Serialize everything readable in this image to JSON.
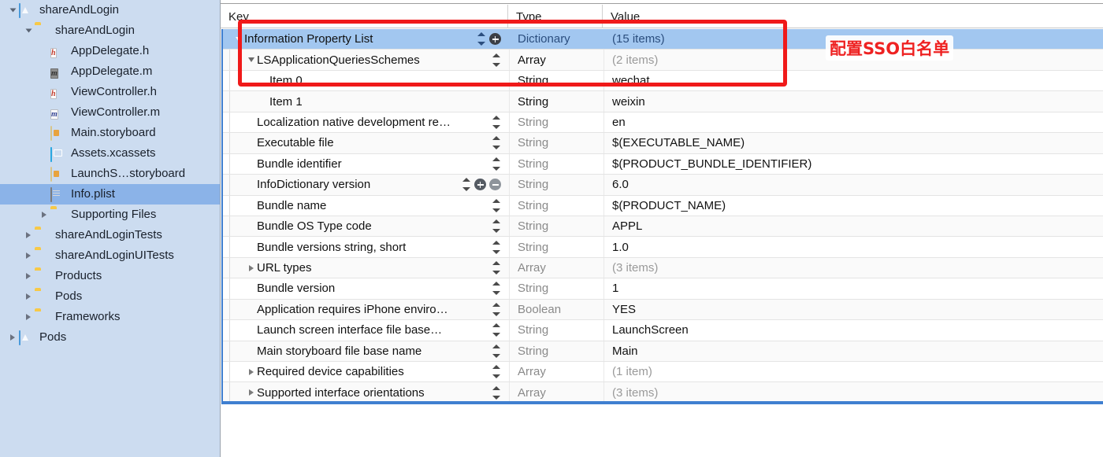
{
  "navigator": {
    "items": [
      {
        "label": "shareAndLogin",
        "icon": "project-icon",
        "indent": 0,
        "disclosure": "open",
        "selected": false
      },
      {
        "label": "shareAndLogin",
        "icon": "folder-icon",
        "indent": 1,
        "disclosure": "open",
        "selected": false
      },
      {
        "label": "AppDelegate.h",
        "icon": "header-file-icon",
        "glyph": "h",
        "indent": 2,
        "disclosure": "none",
        "selected": false
      },
      {
        "label": "AppDelegate.m",
        "icon": "implementation-file-icon",
        "glyph": "m",
        "indent": 2,
        "disclosure": "none",
        "selected": false
      },
      {
        "label": "ViewController.h",
        "icon": "header-file-icon",
        "glyph": "h",
        "indent": 2,
        "disclosure": "none",
        "selected": false
      },
      {
        "label": "ViewController.m",
        "icon": "implementation-file-icon",
        "glyph": "m",
        "indent": 2,
        "disclosure": "none",
        "selected": false
      },
      {
        "label": "Main.storyboard",
        "icon": "storyboard-icon",
        "indent": 2,
        "disclosure": "none",
        "selected": false
      },
      {
        "label": "Assets.xcassets",
        "icon": "assets-catalog-icon",
        "indent": 2,
        "disclosure": "none",
        "selected": false
      },
      {
        "label": "LaunchS…storyboard",
        "icon": "storyboard-icon",
        "indent": 2,
        "disclosure": "none",
        "selected": false
      },
      {
        "label": "Info.plist",
        "icon": "plist-icon",
        "indent": 2,
        "disclosure": "none",
        "selected": true
      },
      {
        "label": "Supporting Files",
        "icon": "folder-icon",
        "indent": 2,
        "disclosure": "closed",
        "selected": false
      },
      {
        "label": "shareAndLoginTests",
        "icon": "folder-icon",
        "indent": 1,
        "disclosure": "closed",
        "selected": false
      },
      {
        "label": "shareAndLoginUITests",
        "icon": "folder-icon",
        "indent": 1,
        "disclosure": "closed",
        "selected": false
      },
      {
        "label": "Products",
        "icon": "folder-icon",
        "indent": 1,
        "disclosure": "closed",
        "selected": false
      },
      {
        "label": "Pods",
        "icon": "folder-icon",
        "indent": 1,
        "disclosure": "closed",
        "selected": false
      },
      {
        "label": "Frameworks",
        "icon": "folder-icon",
        "indent": 1,
        "disclosure": "closed",
        "selected": false
      },
      {
        "label": "Pods",
        "icon": "project-icon",
        "indent": 0,
        "disclosure": "closed",
        "selected": false
      }
    ]
  },
  "plist": {
    "columns": {
      "key": "Key",
      "type": "Type",
      "value": "Value"
    },
    "rows": [
      {
        "key": "Information Property List",
        "type": "Dictionary",
        "value": "(15 items)",
        "indent": 0,
        "disclosure": "open",
        "selected": true,
        "add_button": true,
        "stepper": true,
        "value_muted": true,
        "type_muted": true
      },
      {
        "key": "LSApplicationQueriesSchemes",
        "type": "Array",
        "value": "(2 items)",
        "indent": 1,
        "disclosure": "open",
        "selected": false,
        "stepper": true,
        "value_muted": true,
        "type_muted": false
      },
      {
        "key": "Item 0",
        "type": "String",
        "value": "wechat",
        "indent": 2,
        "disclosure": "none",
        "selected": false,
        "stepper": false,
        "value_muted": false,
        "type_muted": false
      },
      {
        "key": "Item 1",
        "type": "String",
        "value": "weixin",
        "indent": 2,
        "disclosure": "none",
        "selected": false,
        "stepper": false,
        "value_muted": false,
        "type_muted": false
      },
      {
        "key": "Localization native development re…",
        "type": "String",
        "value": "en",
        "indent": 1,
        "disclosure": "none",
        "selected": false,
        "stepper": true,
        "value_muted": false,
        "type_muted": true
      },
      {
        "key": "Executable file",
        "type": "String",
        "value": "$(EXECUTABLE_NAME)",
        "indent": 1,
        "disclosure": "none",
        "selected": false,
        "stepper": true,
        "value_muted": false,
        "type_muted": true
      },
      {
        "key": "Bundle identifier",
        "type": "String",
        "value": "$(PRODUCT_BUNDLE_IDENTIFIER)",
        "indent": 1,
        "disclosure": "none",
        "selected": false,
        "stepper": true,
        "value_muted": false,
        "type_muted": true
      },
      {
        "key": "InfoDictionary version",
        "type": "String",
        "value": "6.0",
        "indent": 1,
        "disclosure": "none",
        "selected": false,
        "stepper": true,
        "add_button": true,
        "remove_button": true,
        "value_muted": false,
        "type_muted": true
      },
      {
        "key": "Bundle name",
        "type": "String",
        "value": "$(PRODUCT_NAME)",
        "indent": 1,
        "disclosure": "none",
        "selected": false,
        "stepper": true,
        "value_muted": false,
        "type_muted": true
      },
      {
        "key": "Bundle OS Type code",
        "type": "String",
        "value": "APPL",
        "indent": 1,
        "disclosure": "none",
        "selected": false,
        "stepper": true,
        "value_muted": false,
        "type_muted": true
      },
      {
        "key": "Bundle versions string, short",
        "type": "String",
        "value": "1.0",
        "indent": 1,
        "disclosure": "none",
        "selected": false,
        "stepper": true,
        "value_muted": false,
        "type_muted": true
      },
      {
        "key": "URL types",
        "type": "Array",
        "value": "(3 items)",
        "indent": 1,
        "disclosure": "closed",
        "selected": false,
        "stepper": true,
        "value_muted": true,
        "type_muted": true
      },
      {
        "key": "Bundle version",
        "type": "String",
        "value": "1",
        "indent": 1,
        "disclosure": "none",
        "selected": false,
        "stepper": true,
        "value_muted": false,
        "type_muted": true
      },
      {
        "key": "Application requires iPhone enviro…",
        "type": "Boolean",
        "value": "YES",
        "indent": 1,
        "disclosure": "none",
        "selected": false,
        "stepper": true,
        "value_muted": false,
        "type_muted": true
      },
      {
        "key": "Launch screen interface file base…",
        "type": "String",
        "value": "LaunchScreen",
        "indent": 1,
        "disclosure": "none",
        "selected": false,
        "stepper": true,
        "value_muted": false,
        "type_muted": true
      },
      {
        "key": "Main storyboard file base name",
        "type": "String",
        "value": "Main",
        "indent": 1,
        "disclosure": "none",
        "selected": false,
        "stepper": true,
        "value_muted": false,
        "type_muted": true
      },
      {
        "key": "Required device capabilities",
        "type": "Array",
        "value": "(1 item)",
        "indent": 1,
        "disclosure": "closed",
        "selected": false,
        "stepper": true,
        "value_muted": true,
        "type_muted": true
      },
      {
        "key": "Supported interface orientations",
        "type": "Array",
        "value": "(3 items)",
        "indent": 1,
        "disclosure": "closed",
        "selected": false,
        "stepper": true,
        "value_muted": true,
        "type_muted": true
      }
    ]
  },
  "annotations": {
    "sso_note": "配置SSO白名单",
    "highlight_color": "#f01a1a",
    "note_color": "#ee2222"
  }
}
